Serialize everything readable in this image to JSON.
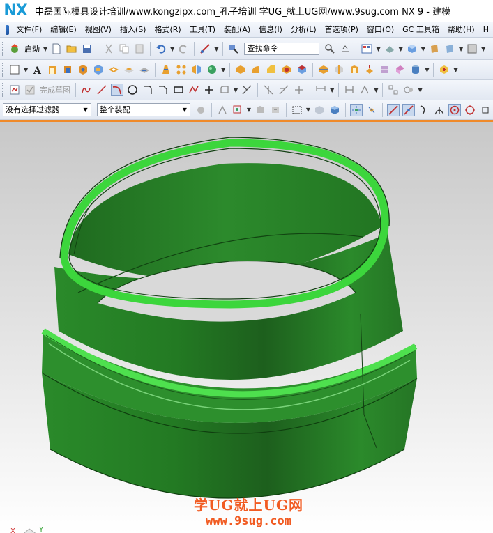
{
  "app": {
    "logo": "NX",
    "title": "中磊国际模具设计培训/www.kongzipx.com_孔子培训  学UG_就上UG网/www.9sug.com NX 9 - 建模"
  },
  "menu": [
    "文件(F)",
    "编辑(E)",
    "视图(V)",
    "插入(S)",
    "格式(R)",
    "工具(T)",
    "装配(A)",
    "信息(I)",
    "分析(L)",
    "首选项(P)",
    "窗口(O)",
    "GC 工具箱",
    "帮助(H)",
    "H"
  ],
  "toolbar1": {
    "start_label": "启动",
    "search_placeholder": "查找命令"
  },
  "toolbar3": {
    "sketch_label": "完成草图"
  },
  "toolbar4": {
    "filter_value": "没有选择过滤器",
    "scope_value": "整个装配"
  },
  "viewport": {
    "model_color": "#2e8b2e",
    "highlight_color": "#3ccf3c",
    "accent": "#f08a2a"
  },
  "watermark": {
    "line1": "学UG就上UG网",
    "line2": "www.9sug.com"
  },
  "triad": {
    "x_label": "X",
    "y_label": "Y"
  }
}
